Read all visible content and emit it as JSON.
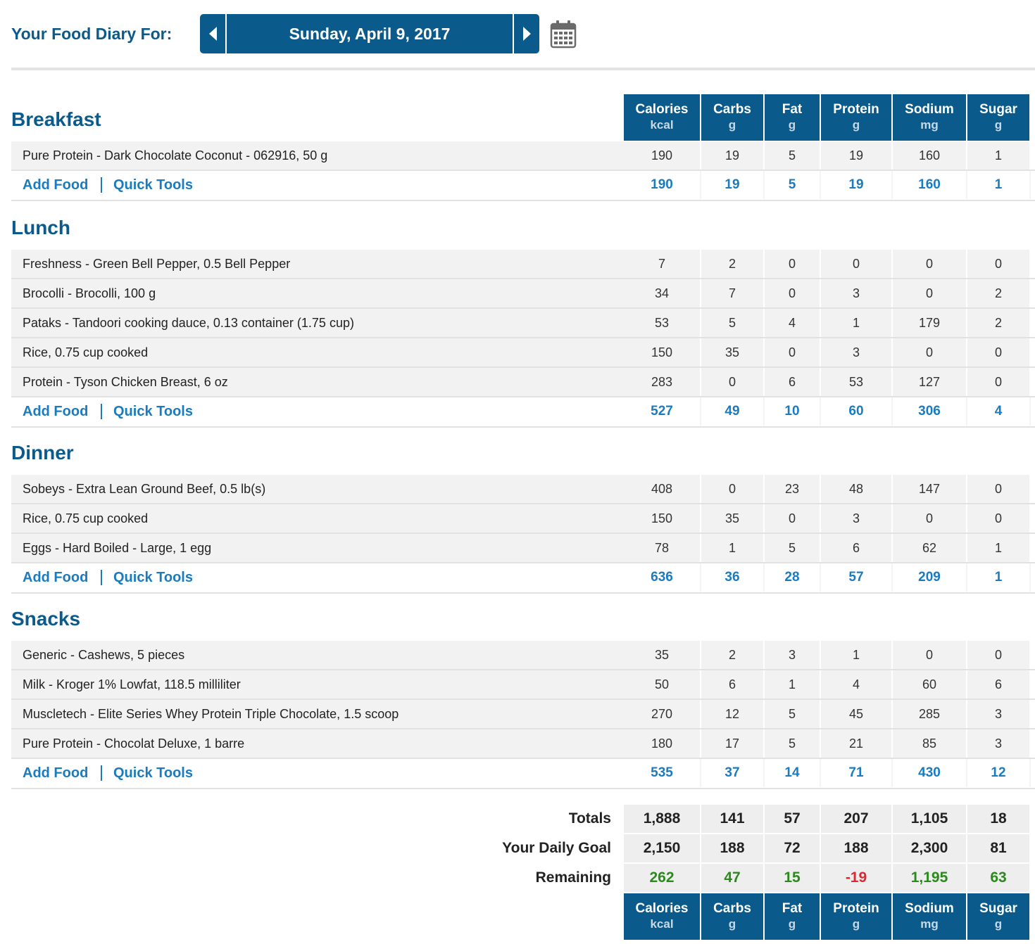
{
  "header": {
    "label": "Your Food Diary For:",
    "date": "Sunday, April 9, 2017",
    "prev_icon": "triangle-left-icon",
    "next_icon": "triangle-right-icon",
    "calendar_icon": "calendar-icon"
  },
  "colors": {
    "brand_blue": "#0a5a8c",
    "link_blue": "#1b7bbf",
    "remaining_positive": "#2b8a1c",
    "remaining_negative": "#e0262e"
  },
  "columns": [
    {
      "name": "Calories",
      "unit": "kcal"
    },
    {
      "name": "Carbs",
      "unit": "g"
    },
    {
      "name": "Fat",
      "unit": "g"
    },
    {
      "name": "Protein",
      "unit": "g"
    },
    {
      "name": "Sodium",
      "unit": "mg"
    },
    {
      "name": "Sugar",
      "unit": "g"
    }
  ],
  "links": {
    "add_food": "Add Food",
    "quick_tools": "Quick Tools"
  },
  "meals": [
    {
      "name": "Breakfast",
      "foods": [
        {
          "name": "Pure Protein - Dark Chocolate Coconut - 062916, 50 g",
          "values": [
            "190",
            "19",
            "5",
            "19",
            "160",
            "1"
          ]
        }
      ],
      "totals": [
        "190",
        "19",
        "5",
        "19",
        "160",
        "1"
      ]
    },
    {
      "name": "Lunch",
      "foods": [
        {
          "name": "Freshness - Green Bell Pepper, 0.5 Bell Pepper",
          "values": [
            "7",
            "2",
            "0",
            "0",
            "0",
            "0"
          ]
        },
        {
          "name": "Brocolli - Brocolli, 100 g",
          "values": [
            "34",
            "7",
            "0",
            "3",
            "0",
            "2"
          ]
        },
        {
          "name": "Pataks - Tandoori cooking dauce, 0.13 container (1.75 cup)",
          "values": [
            "53",
            "5",
            "4",
            "1",
            "179",
            "2"
          ]
        },
        {
          "name": "Rice, 0.75 cup cooked",
          "values": [
            "150",
            "35",
            "0",
            "3",
            "0",
            "0"
          ]
        },
        {
          "name": "Protein - Tyson Chicken Breast, 6 oz",
          "values": [
            "283",
            "0",
            "6",
            "53",
            "127",
            "0"
          ]
        }
      ],
      "totals": [
        "527",
        "49",
        "10",
        "60",
        "306",
        "4"
      ]
    },
    {
      "name": "Dinner",
      "foods": [
        {
          "name": "Sobeys - Extra Lean Ground Beef, 0.5 lb(s)",
          "values": [
            "408",
            "0",
            "23",
            "48",
            "147",
            "0"
          ]
        },
        {
          "name": "Rice, 0.75 cup cooked",
          "values": [
            "150",
            "35",
            "0",
            "3",
            "0",
            "0"
          ]
        },
        {
          "name": "Eggs - Hard Boiled - Large, 1 egg",
          "values": [
            "78",
            "1",
            "5",
            "6",
            "62",
            "1"
          ]
        }
      ],
      "totals": [
        "636",
        "36",
        "28",
        "57",
        "209",
        "1"
      ]
    },
    {
      "name": "Snacks",
      "foods": [
        {
          "name": "Generic - Cashews, 5 pieces",
          "values": [
            "35",
            "2",
            "3",
            "1",
            "0",
            "0"
          ]
        },
        {
          "name": "Milk - Kroger 1% Lowfat, 118.5 milliliter",
          "values": [
            "50",
            "6",
            "1",
            "4",
            "60",
            "6"
          ]
        },
        {
          "name": "Muscletech - Elite Series Whey Protein Triple Chocolate, 1.5 scoop",
          "values": [
            "270",
            "12",
            "5",
            "45",
            "285",
            "3"
          ]
        },
        {
          "name": "Pure Protein - Chocolat Deluxe, 1 barre",
          "values": [
            "180",
            "17",
            "5",
            "21",
            "85",
            "3"
          ]
        }
      ],
      "totals": [
        "535",
        "37",
        "14",
        "71",
        "430",
        "12"
      ]
    }
  ],
  "summary": {
    "totals": {
      "label": "Totals",
      "values": [
        "1,888",
        "141",
        "57",
        "207",
        "1,105",
        "18"
      ]
    },
    "goal": {
      "label": "Your Daily Goal",
      "values": [
        "2,150",
        "188",
        "72",
        "188",
        "2,300",
        "81"
      ]
    },
    "remaining": {
      "label": "Remaining",
      "values": [
        "262",
        "47",
        "15",
        "-19",
        "1,195",
        "63"
      ]
    }
  }
}
